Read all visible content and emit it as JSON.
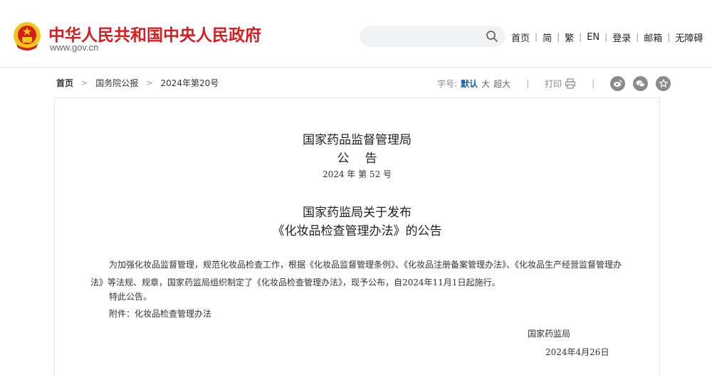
{
  "header": {
    "site_name": "中华人民共和国中央人民政府",
    "site_url": "www.gov.cn",
    "search": {
      "value": "",
      "placeholder": ""
    },
    "nav": [
      "首页",
      "简",
      "繁",
      "EN",
      "登录",
      "邮箱",
      "无障碍"
    ],
    "colors": {
      "brand_red": "#d51e20",
      "emblem_gold": "#f5c518"
    }
  },
  "breadcrumb": [
    "首页",
    "国务院公报",
    "2024年第20号"
  ],
  "tools": {
    "font_size_label": "字号:",
    "font_sizes": [
      "默认",
      "大",
      "超大"
    ],
    "active_font_size": "默认",
    "print_label": "打印",
    "share_icons": [
      "weibo-icon",
      "wechat-icon",
      "favorite-star-icon"
    ]
  },
  "document": {
    "agency": "国家药品监督管理局",
    "notice_word": "公告",
    "doc_number": "2024 年 第 52 号",
    "title_line1": "国家药监局关于发布",
    "title_line2": "《化妆品检查管理办法》的公告",
    "paragraph": "为加强化妆品监督管理，规范化妆品检查工作，根据《化妆品监督管理条例》、《化妆品注册备案管理办法》、《化妆品生产经营监督管理办法》等法规、规章，国家药监局组织制定了《化妆品检查管理办法》，现予公布，自2024年11月1日起施行。",
    "special_notice": "特此公告。",
    "attachment_label": "附件：",
    "attachment_name": "化妆品检查管理办法",
    "signer": "国家药监局",
    "date": "2024年4月26日"
  }
}
